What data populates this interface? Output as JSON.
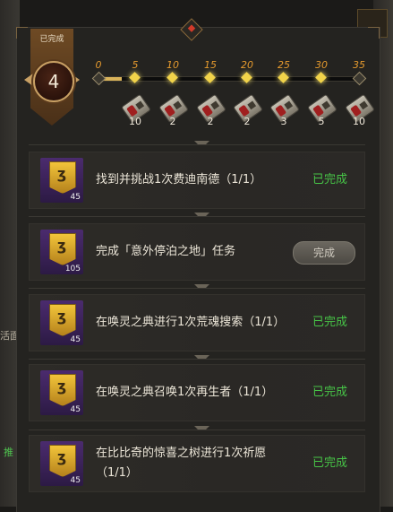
{
  "banner": {
    "label": "已完成",
    "count": "4"
  },
  "progress": {
    "milestones": [
      "0",
      "5",
      "10",
      "15",
      "20",
      "25",
      "30",
      "35"
    ],
    "fill_fraction": 0.09,
    "rewards": [
      "10",
      "2",
      "2",
      "2",
      "3",
      "5",
      "10"
    ]
  },
  "tasks": [
    {
      "text": "找到并挑战1次费迪南德（1/1）",
      "icon_number": "45",
      "status": "已完成",
      "button": ""
    },
    {
      "text": "完成「意外停泊之地」任务",
      "icon_number": "105",
      "status": "",
      "button": "完成"
    },
    {
      "text": "在唤灵之典进行1次荒魂搜索（1/1）",
      "icon_number": "45",
      "status": "已完成",
      "button": ""
    },
    {
      "text": "在唤灵之典召唤1次再生者（1/1）",
      "icon_number": "45",
      "status": "已完成",
      "button": ""
    },
    {
      "text": "在比比奇的惊喜之树进行1次祈愿（1/1）",
      "icon_number": "45",
      "status": "已完成",
      "button": ""
    }
  ],
  "side": {
    "left_text": "活面",
    "left_green": "推"
  },
  "colors": {
    "completed": "#47c447",
    "milestone": "#e59a2e",
    "gold": "#f1d34a"
  },
  "icons": {
    "banner_medal": "medal-icon",
    "reward": "chest-icon",
    "task": "flag-icon"
  }
}
